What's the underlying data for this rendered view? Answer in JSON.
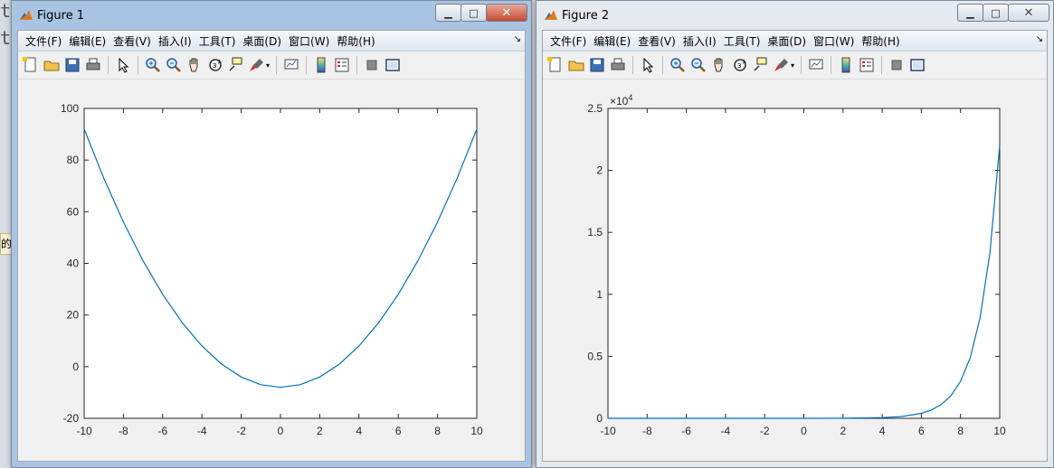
{
  "background": {
    "text_lines": [
      "t",
      "t"
    ],
    "strip_text": "的"
  },
  "windows": [
    {
      "id": "win1",
      "title": "Figure 1",
      "controls": {
        "minimize": "▁",
        "maximize": "□",
        "close": "✕"
      },
      "menus": [
        "文件(F)",
        "编辑(E)",
        "查看(V)",
        "插入(I)",
        "工具(T)",
        "桌面(D)",
        "窗口(W)",
        "帮助(H)"
      ],
      "menu_overflow": "↘",
      "toolbar_icons": [
        "new-figure-icon",
        "open-file-icon",
        "save-icon",
        "print-icon",
        "pointer-icon",
        "zoom-in-icon",
        "zoom-out-icon",
        "pan-hand-icon",
        "rotate-3d-icon",
        "data-cursor-icon",
        "brush-icon",
        "link-plot-icon",
        "colorbar-icon",
        "legend-icon",
        "hide-plot-tools-icon",
        "show-plot-tools-icon"
      ]
    },
    {
      "id": "win2",
      "title": "Figure 2",
      "controls": {
        "minimize": "▁",
        "maximize": "□",
        "close": "✕"
      },
      "menus": [
        "文件(F)",
        "编辑(E)",
        "查看(V)",
        "插入(I)",
        "工具(T)",
        "桌面(D)",
        "窗口(W)",
        "帮助(H)"
      ],
      "menu_overflow": "↘",
      "toolbar_icons": [
        "new-figure-icon",
        "open-file-icon",
        "save-icon",
        "print-icon",
        "pointer-icon",
        "zoom-in-icon",
        "zoom-out-icon",
        "pan-hand-icon",
        "rotate-3d-icon",
        "data-cursor-icon",
        "brush-icon",
        "link-plot-icon",
        "colorbar-icon",
        "legend-icon",
        "hide-plot-tools-icon",
        "show-plot-tools-icon"
      ]
    }
  ],
  "chart_data": [
    {
      "type": "line",
      "function": "x^2 - 8",
      "xlim": [
        -10,
        10
      ],
      "ylim": [
        -20,
        100
      ],
      "xticks": [
        "-10",
        "-8",
        "-6",
        "-4",
        "-2",
        "0",
        "2",
        "4",
        "6",
        "8",
        "10"
      ],
      "yticks": [
        "-20",
        "0",
        "20",
        "40",
        "60",
        "80",
        "100"
      ],
      "series": [
        {
          "color": "#0072bd",
          "x": [
            -10,
            -9,
            -8,
            -7,
            -6,
            -5,
            -4,
            -3,
            -2,
            -1,
            0,
            1,
            2,
            3,
            4,
            5,
            6,
            7,
            8,
            9,
            10
          ],
          "y": [
            92,
            73,
            56,
            41,
            28,
            17,
            8,
            1,
            -4,
            -7,
            -8,
            -7,
            -4,
            1,
            8,
            17,
            28,
            41,
            56,
            73,
            92
          ]
        }
      ],
      "grid": false
    },
    {
      "type": "line",
      "function": "exp(x)",
      "xlim": [
        -10,
        10
      ],
      "ylim": [
        0,
        25000
      ],
      "exponent_label": "×10",
      "exponent_power": "4",
      "xticks": [
        "-10",
        "-8",
        "-6",
        "-4",
        "-2",
        "0",
        "2",
        "4",
        "6",
        "8",
        "10"
      ],
      "yticks": [
        "0",
        "0.5",
        "1",
        "1.5",
        "2",
        "2.5"
      ],
      "series": [
        {
          "color": "#0072bd",
          "x": [
            -10,
            -8,
            -6,
            -4,
            -2,
            0,
            2,
            4,
            5,
            6,
            6.5,
            7,
            7.5,
            8,
            8.5,
            9,
            9.5,
            10
          ],
          "y": [
            0,
            0,
            0,
            0,
            0,
            1,
            7,
            55,
            148,
            403,
            665,
            1097,
            1808,
            2981,
            4915,
            8103,
            13360,
            22026
          ]
        }
      ],
      "grid": false
    }
  ]
}
